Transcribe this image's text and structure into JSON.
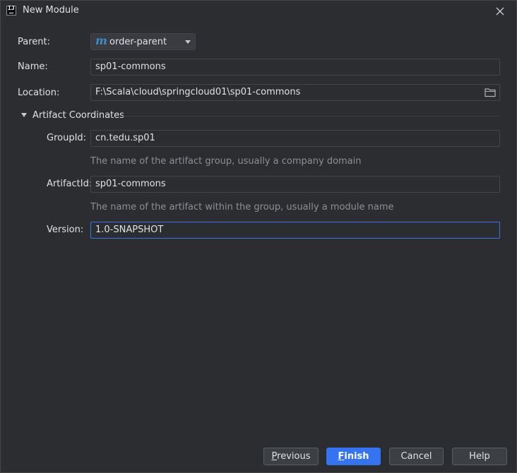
{
  "window": {
    "title": "New Module"
  },
  "form": {
    "parent": {
      "label": "Parent:",
      "value": "order-parent",
      "icon": "m"
    },
    "name": {
      "label": "Name:",
      "value": "sp01-commons"
    },
    "location": {
      "label": "Location:",
      "value": "F:\\Scala\\cloud\\springcloud01\\sp01-commons"
    }
  },
  "artifact": {
    "section_title": "Artifact Coordinates",
    "group_id": {
      "label": "GroupId:",
      "value": "cn.tedu.sp01",
      "hint": "The name of the artifact group, usually a company domain"
    },
    "artifact_id": {
      "label": "ArtifactId:",
      "value": "sp01-commons",
      "hint": "The name of the artifact within the group, usually a module name"
    },
    "version": {
      "label": "Version:",
      "value": "1.0-SNAPSHOT"
    }
  },
  "buttons": {
    "previous": {
      "mnemonic": "P",
      "rest": "revious"
    },
    "finish": {
      "mnemonic": "F",
      "rest": "inish"
    },
    "cancel": "Cancel",
    "help": "Help"
  },
  "colors": {
    "background": "#2b2d30",
    "field_border": "#43454a",
    "accent": "#3574f0",
    "maven_icon": "#3d8cc9",
    "hint_text": "#8c8f94"
  }
}
